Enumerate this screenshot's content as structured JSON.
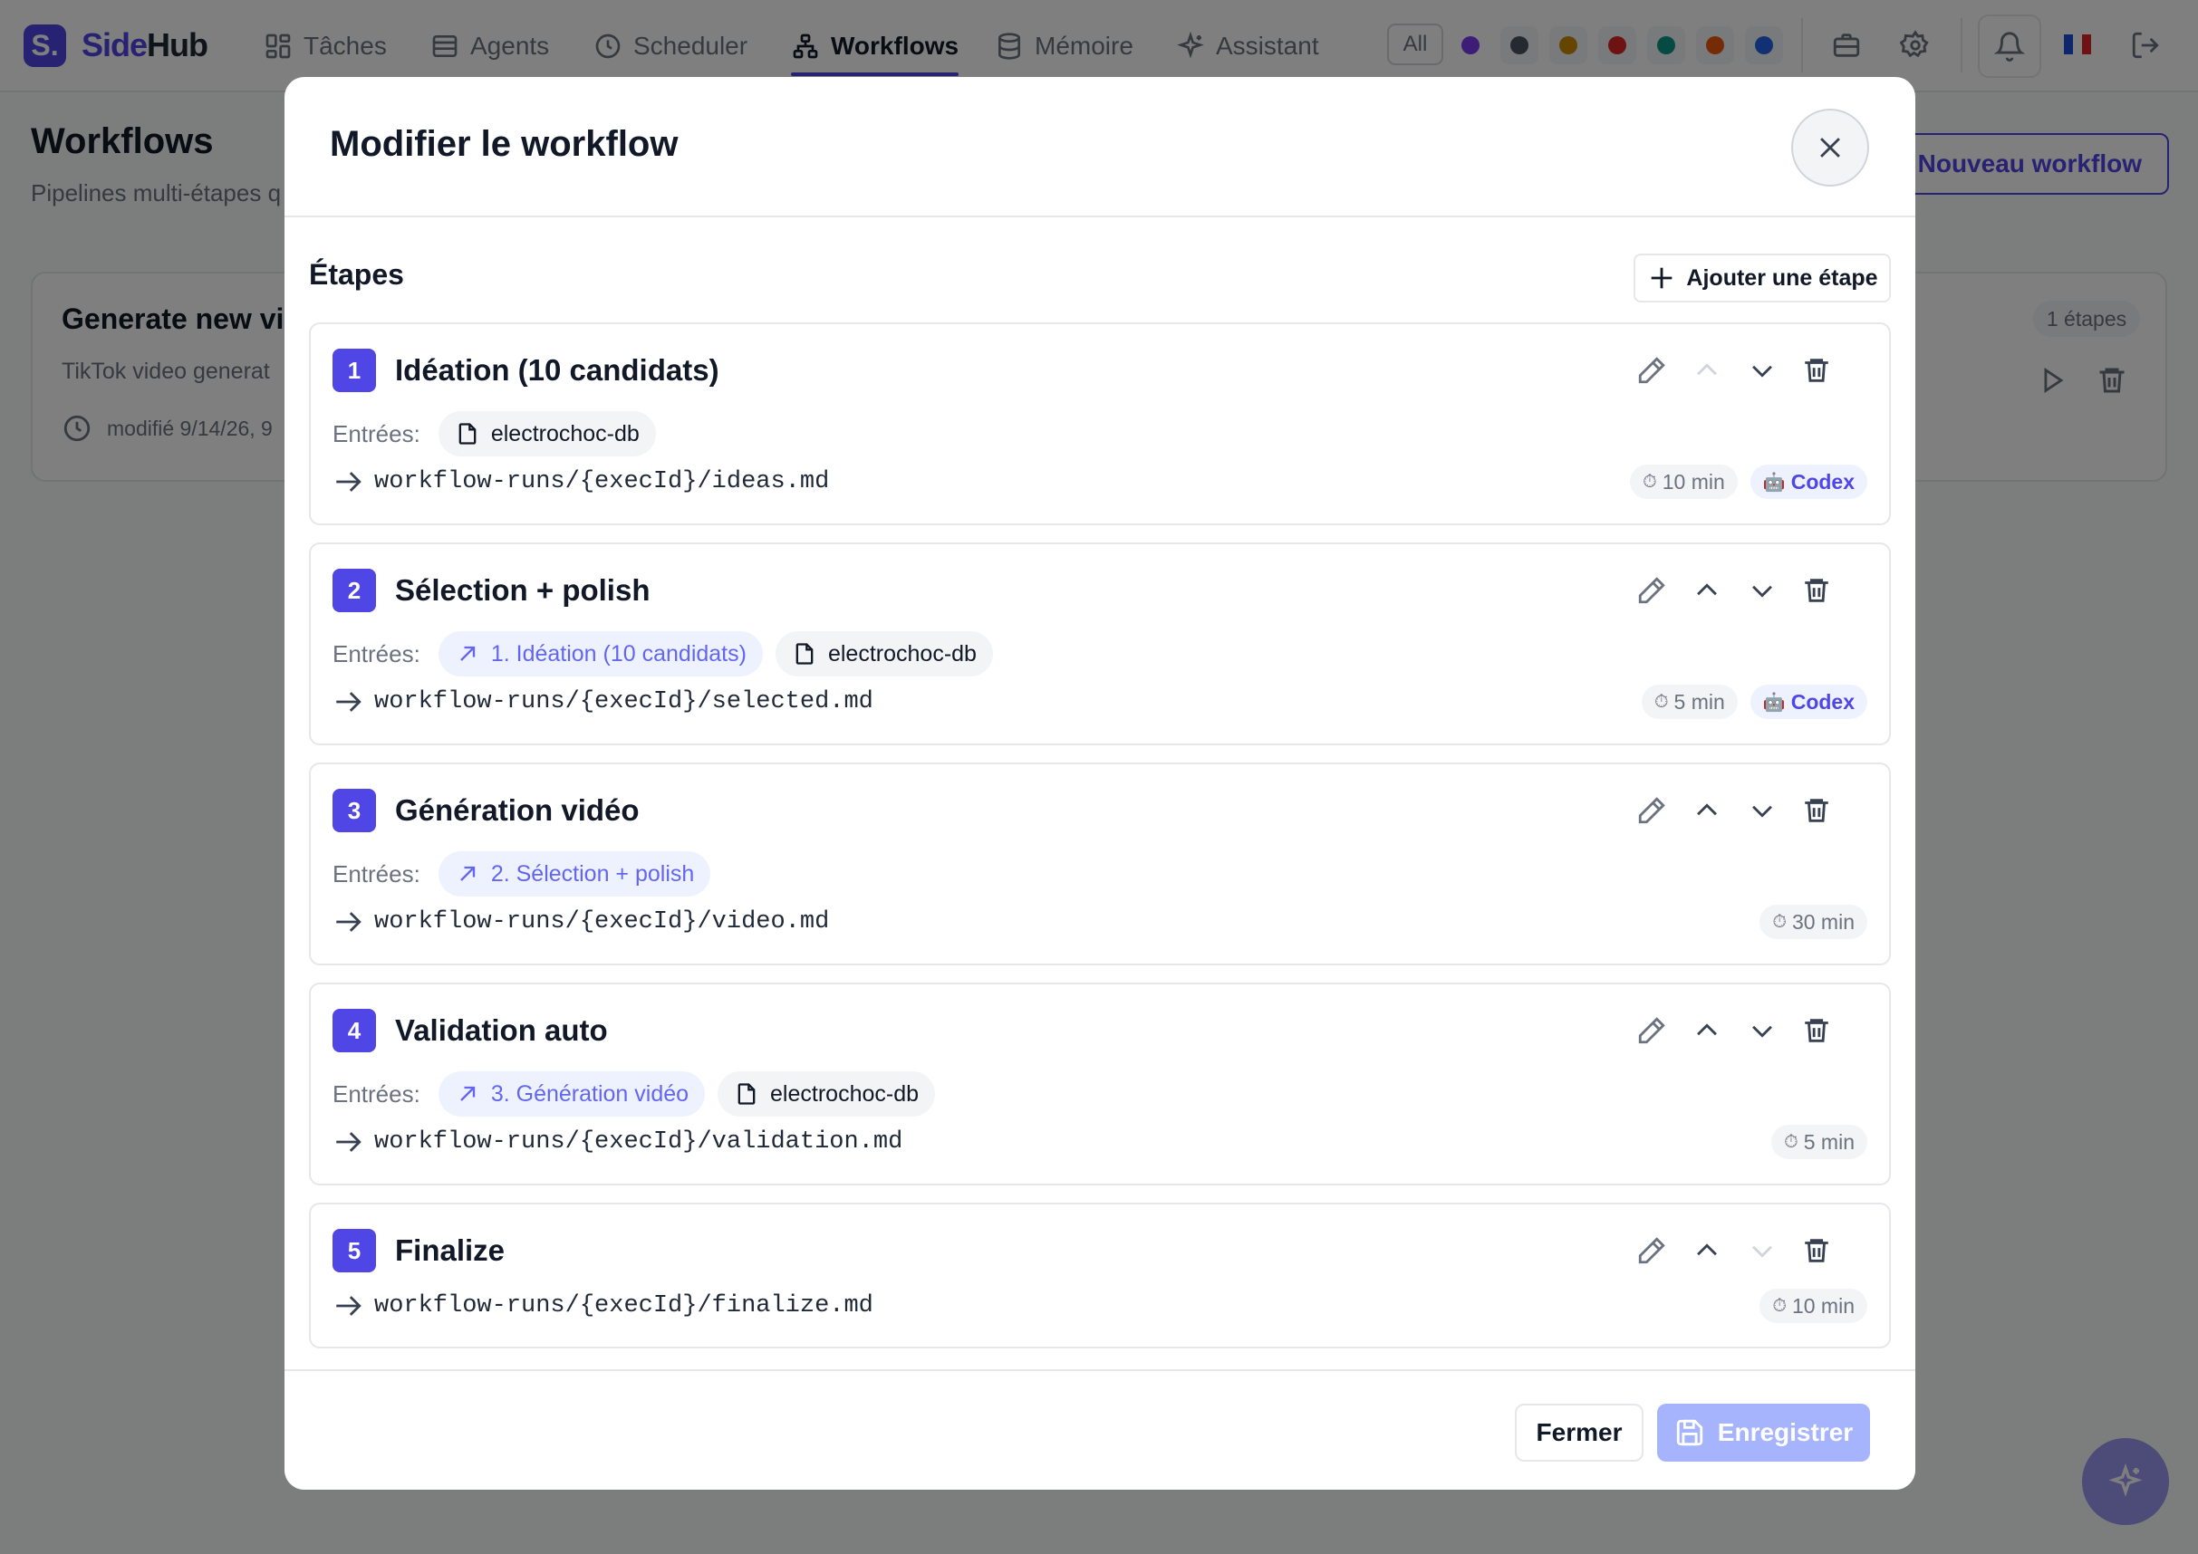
{
  "app": {
    "logo_letter": "S.",
    "logo_text_primary": "Side",
    "logo_text_secondary": "Hub"
  },
  "nav": [
    {
      "label": "Tâches",
      "icon": "layout-grid-icon",
      "active": false
    },
    {
      "label": "Agents",
      "icon": "server-icon",
      "active": false
    },
    {
      "label": "Scheduler",
      "icon": "clock-icon",
      "active": false
    },
    {
      "label": "Workflows",
      "icon": "workflow-icon",
      "active": true
    },
    {
      "label": "Mémoire",
      "icon": "database-icon",
      "active": false
    },
    {
      "label": "Assistant",
      "icon": "sparkles-icon",
      "active": false
    }
  ],
  "filters": {
    "all_label": "All",
    "colors": [
      "#7c3aed",
      "#4b5563",
      "#ca8a04",
      "#dc2626",
      "#0d9488",
      "#ea580c",
      "#2563eb"
    ]
  },
  "page": {
    "title": "Workflows",
    "subtitle": "Pipelines multi-étapes q",
    "new_button": "Nouveau workflow"
  },
  "bg_card": {
    "title": "Generate new vic",
    "description": "TikTok video generat",
    "modified": "modifié 9/14/26, 9",
    "steps_badge": "1 étapes"
  },
  "modal": {
    "title": "Modifier le workflow",
    "section_title": "Étapes",
    "add_step": "Ajouter une étape",
    "inputs_label": "Entrées:",
    "steps": [
      {
        "number": "1",
        "title": "Idéation (10 candidats)",
        "inputs": [
          {
            "type": "file",
            "label": "electrochoc-db"
          }
        ],
        "output": "workflow-runs/{execId}/ideas.md",
        "timeout": "10 min",
        "agent": "Codex",
        "up_disabled": true,
        "down_disabled": false
      },
      {
        "number": "2",
        "title": "Sélection + polish",
        "inputs": [
          {
            "type": "ref",
            "label": "1. Idéation (10 candidats)"
          },
          {
            "type": "file",
            "label": "electrochoc-db"
          }
        ],
        "output": "workflow-runs/{execId}/selected.md",
        "timeout": "5 min",
        "agent": "Codex",
        "up_disabled": false,
        "down_disabled": false
      },
      {
        "number": "3",
        "title": "Génération vidéo",
        "inputs": [
          {
            "type": "ref",
            "label": "2. Sélection + polish"
          }
        ],
        "output": "workflow-runs/{execId}/video.md",
        "timeout": "30 min",
        "agent": "",
        "up_disabled": false,
        "down_disabled": false
      },
      {
        "number": "4",
        "title": "Validation auto",
        "inputs": [
          {
            "type": "ref",
            "label": "3. Génération vidéo"
          },
          {
            "type": "file",
            "label": "electrochoc-db"
          }
        ],
        "output": "workflow-runs/{execId}/validation.md",
        "timeout": "5 min",
        "agent": "",
        "up_disabled": false,
        "down_disabled": false
      },
      {
        "number": "5",
        "title": "Finalize",
        "inputs": [],
        "output": "workflow-runs/{execId}/finalize.md",
        "timeout": "10 min",
        "agent": "",
        "up_disabled": false,
        "down_disabled": true
      }
    ],
    "footer": {
      "close_label": "Fermer",
      "save_label": "Enregistrer"
    }
  }
}
